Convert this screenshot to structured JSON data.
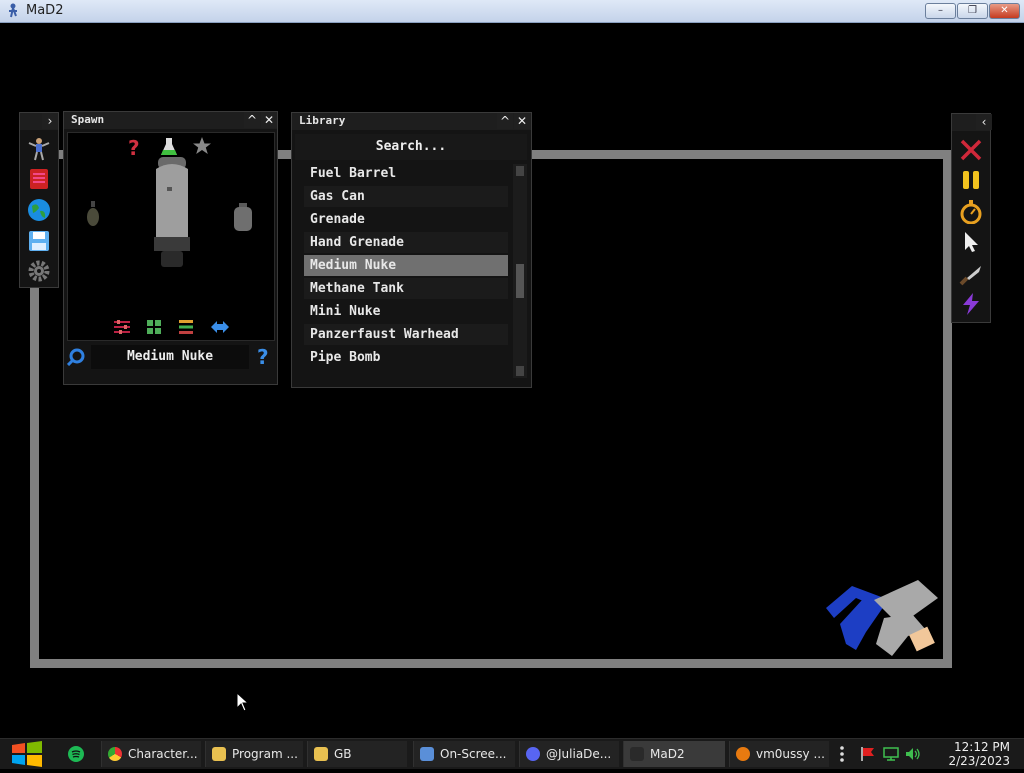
{
  "window": {
    "title": "MaD2",
    "minimize": "–",
    "maximize": "❐",
    "close": "✕"
  },
  "spawn_panel": {
    "title": "Spawn",
    "collapse": "^",
    "close": "✕",
    "selected_item": "Medium Nuke",
    "help": "?",
    "random": "?"
  },
  "library_panel": {
    "title": "Library",
    "collapse": "^",
    "close": "✕",
    "search": "Search...",
    "items": [
      {
        "label": "Fuel Barrel"
      },
      {
        "label": "Gas Can"
      },
      {
        "label": "Grenade"
      },
      {
        "label": "Hand Grenade"
      },
      {
        "label": "Medium Nuke"
      },
      {
        "label": "Methane Tank"
      },
      {
        "label": "Mini Nuke"
      },
      {
        "label": "Panzerfaust Warhead"
      },
      {
        "label": "Pipe Bomb"
      }
    ],
    "selected": "Medium Nuke"
  },
  "left_toolbar": {
    "expand": "›",
    "icons": [
      "character-icon",
      "book-icon",
      "globe-icon",
      "save-icon",
      "gear-icon"
    ]
  },
  "right_toolbar": {
    "collapse": "‹",
    "icons": [
      "close-icon",
      "pause-icon",
      "stopwatch-icon",
      "cursor-icon",
      "knife-icon",
      "lightning-icon"
    ]
  },
  "taskbar": {
    "tasks": [
      {
        "label": "Character..."
      },
      {
        "label": "Program ..."
      },
      {
        "label": "GB"
      },
      {
        "label": "On-Scree..."
      },
      {
        "label": "@JuliaDe..."
      },
      {
        "label": "MaD2"
      },
      {
        "label": "vm0ussy ..."
      }
    ],
    "time": "12:12 PM",
    "date": "2/23/2023"
  },
  "colors": {
    "arena_border": "#808080",
    "selected_row": "#707070",
    "accent_blue": "#3aa0ff"
  }
}
